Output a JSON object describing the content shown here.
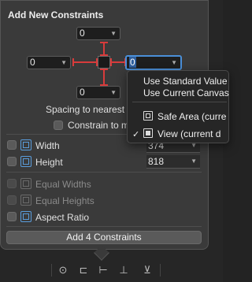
{
  "panel": {
    "title": "Add New Constraints"
  },
  "constraints": {
    "top": "0",
    "left": "0",
    "right": "0",
    "bottom": "0"
  },
  "spacing_label": "Spacing to nearest",
  "constrain_margins_label": "Constrain to m",
  "size": {
    "width_label": "Width",
    "width_value": "374",
    "height_label": "Height",
    "height_value": "818"
  },
  "equal": {
    "widths_label": "Equal Widths",
    "heights_label": "Equal Heights",
    "aspect_label": "Aspect Ratio"
  },
  "add_button_label": "Add 4 Constraints",
  "menu": {
    "item1": "Use Standard Value",
    "item2": "Use Current Canvas",
    "item3": "Safe Area (curre",
    "item4": "View (current d",
    "check": "✓"
  },
  "toolbar_icons": [
    "resolve-icon",
    "align-icon",
    "add-constraints-icon",
    "resize-icon",
    "embed-icon"
  ],
  "accent_color": "#4a8fd8",
  "strut_color": "#d83b3b"
}
